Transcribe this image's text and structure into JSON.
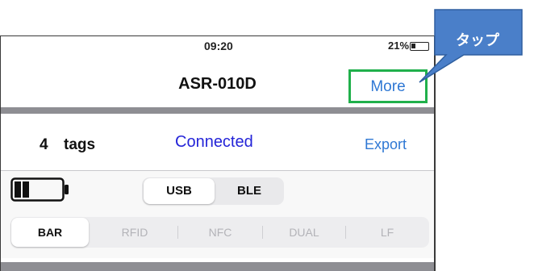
{
  "status_bar": {
    "time": "09:20",
    "battery_percent": "21%"
  },
  "nav_bar": {
    "title": "ASR-010D",
    "more_label": "More"
  },
  "tags_row": {
    "count": "4",
    "tags_label": "tags",
    "connection_status": "Connected",
    "export_label": "Export"
  },
  "connection_segment": {
    "options": [
      "USB",
      "BLE"
    ],
    "selected": "USB"
  },
  "mode_segment": {
    "options": [
      "BAR",
      "RFID",
      "NFC",
      "DUAL",
      "LF"
    ],
    "selected": "BAR"
  },
  "callout": {
    "label": "タップ"
  },
  "colors": {
    "link_blue": "#2f78d4",
    "connected_blue": "#2424d8",
    "highlight_green": "#20b04b",
    "callout_blue": "#4a7fc9"
  }
}
